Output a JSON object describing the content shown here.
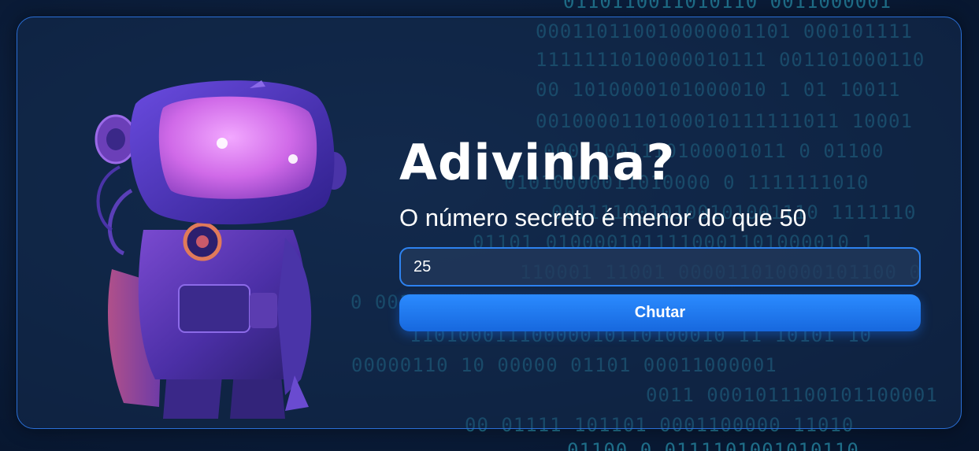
{
  "background": {
    "binary_rows": [
      "0110110011010110     0011000001",
      "000110110010000001101  000101111",
      "1111111010000010111  001101000110",
      "00 1010000101000010   1 01 10011",
      "0010000110100010111111011  10001",
      "00011001110100001011  0 01100",
      "01010000011010000  0  1111111010",
      "0011110010100101001110 1111110",
      "01101  0100001011110001101000010 1",
      "110001 11001  000011010000101100 0",
      "0  0011101000101  01  1101000010",
      "11010001110000010110100010 11 10101 10",
      "00000110  10     00000 01101  00011000001",
      "0011  0001011100101100001",
      "00 01111   101101 0001100000 11010",
      "01100 0 0111101001010110"
    ]
  },
  "colors": {
    "accent": "#2b8bff",
    "card_border": "#2a6fd6",
    "binary_text": "#1f6f8a",
    "robot_glow": "#d06ae8"
  },
  "robot": {
    "icon": "astronaut-robot-illustration"
  },
  "game": {
    "title": "Adivinha?",
    "hint": "O número secreto é menor do que 50",
    "input_value": "25",
    "button_label": "Chutar"
  }
}
